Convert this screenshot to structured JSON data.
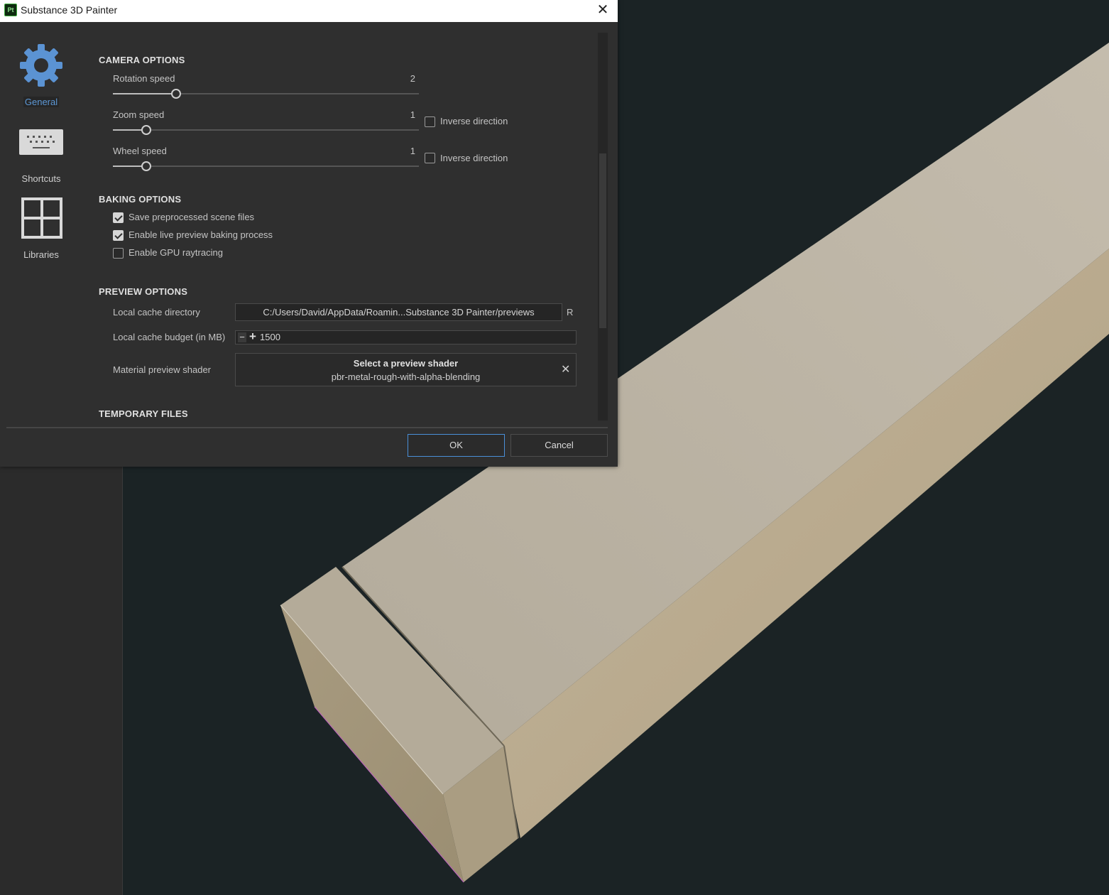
{
  "window": {
    "title": "Substance 3D Painter",
    "app_icon_text": "Pt",
    "close_glyph": "✕"
  },
  "nav": {
    "items": [
      {
        "label": "General",
        "icon": "gear-icon",
        "active": true
      },
      {
        "label": "Shortcuts",
        "icon": "keyboard-icon",
        "active": false
      },
      {
        "label": "Libraries",
        "icon": "grid-icon",
        "active": false
      }
    ]
  },
  "camera": {
    "title": "CAMERA OPTIONS",
    "rotation": {
      "label": "Rotation speed",
      "value": "2"
    },
    "zoom": {
      "label": "Zoom speed",
      "value": "1",
      "inverse_label": "Inverse direction",
      "inverse_checked": false
    },
    "wheel": {
      "label": "Wheel speed",
      "value": "1",
      "inverse_label": "Inverse direction",
      "inverse_checked": false
    }
  },
  "baking": {
    "title": "BAKING OPTIONS",
    "options": [
      {
        "label": "Save preprocessed scene files",
        "checked": true
      },
      {
        "label": "Enable live preview baking process",
        "checked": true
      },
      {
        "label": "Enable GPU raytracing",
        "checked": false
      }
    ]
  },
  "preview": {
    "title": "PREVIEW OPTIONS",
    "cache_dir_label": "Local cache directory",
    "cache_dir_value": "C:/Users/David/AppData/Roamin...Substance 3D Painter/previews",
    "cache_dir_reset": "R",
    "cache_budget_label": "Local cache budget (in MB)",
    "cache_budget_value": "1500",
    "shader_label": "Material preview shader",
    "shader_title": "Select a preview shader",
    "shader_value": "pbr-metal-rough-with-alpha-blending"
  },
  "temporary": {
    "title": "TEMPORARY FILES"
  },
  "buttons": {
    "ok": "OK",
    "cancel": "Cancel"
  },
  "colors": {
    "accent": "#4a90d9",
    "dialog_bg": "#2f2f2f",
    "viewport_bg": "#1b2325",
    "mesh": "#b9ad96"
  }
}
